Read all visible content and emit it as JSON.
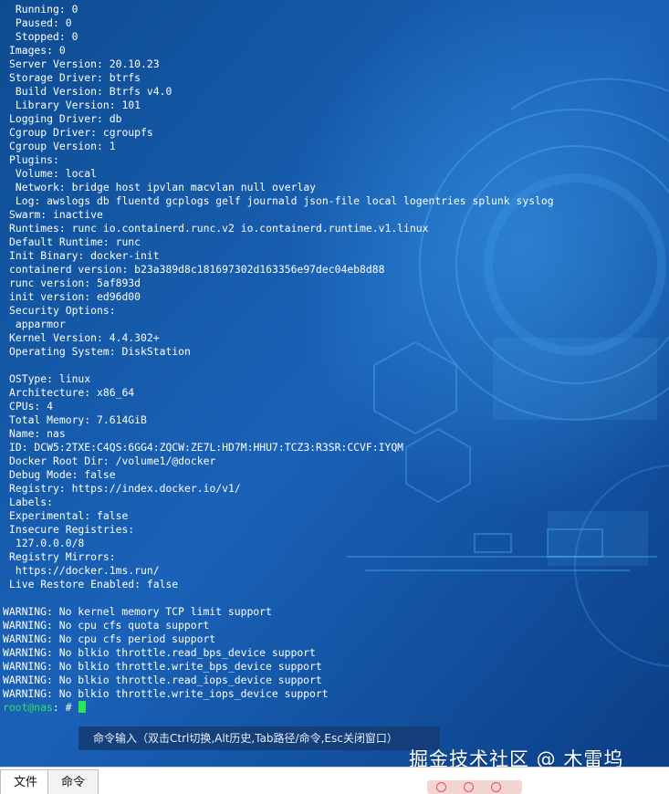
{
  "terminal": {
    "lines": [
      " Running: 0",
      " Paused: 0",
      " Stopped: 0",
      "Images: 0",
      "Server Version: 20.10.23",
      "Storage Driver: btrfs",
      " Build Version: Btrfs v4.0",
      " Library Version: 101",
      "Logging Driver: db",
      "Cgroup Driver: cgroupfs",
      "Cgroup Version: 1",
      "Plugins:",
      " Volume: local",
      " Network: bridge host ipvlan macvlan null overlay",
      " Log: awslogs db fluentd gcplogs gelf journald json-file local logentries splunk syslog",
      "Swarm: inactive",
      "Runtimes: runc io.containerd.runc.v2 io.containerd.runtime.v1.linux",
      "Default Runtime: runc",
      "Init Binary: docker-init",
      "containerd version: b23a389d8c181697302d163356e97dec04eb8d88",
      "runc version: 5af893d",
      "init version: ed96d00",
      "Security Options:",
      " apparmor",
      "Kernel Version: 4.4.302+",
      "Operating System: DiskStation",
      "",
      "OSType: linux",
      "Architecture: x86_64",
      "CPUs: 4",
      "Total Memory: 7.614GiB",
      "Name: nas",
      "ID: DCW5:2TXE:C4QS:6GG4:ZQCW:ZE7L:HD7M:HHU7:TCZ3:R3SR:CCVF:IYQM",
      "Docker Root Dir: /volume1/@docker",
      "Debug Mode: false",
      "Registry: https://index.docker.io/v1/",
      "Labels:",
      "Experimental: false",
      "Insecure Registries:",
      " 127.0.0.0/8",
      "Registry Mirrors:",
      " https://docker.1ms.run/",
      "Live Restore Enabled: false",
      "",
      "WARNING: No kernel memory TCP limit support",
      "WARNING: No cpu cfs quota support",
      "WARNING: No cpu cfs period support",
      "WARNING: No blkio throttle.read_bps_device support",
      "WARNING: No blkio throttle.write_bps_device support",
      "WARNING: No blkio throttle.read_iops_device support",
      "WARNING: No blkio throttle.write_iops_device support"
    ],
    "prompt_user": "root@nas",
    "prompt_sep": ":",
    "prompt_path": " #"
  },
  "command_bar": {
    "placeholder": "命令输入（双击Ctrl切换,Alt历史,Tab路径/命令,Esc关闭窗口）"
  },
  "watermark": "掘金技术社区 @ 木雷坞",
  "bottom_tabs": [
    "文件",
    "命令"
  ],
  "colors": {
    "prompt_user": "#2ee35a",
    "background": "#0b3c7a"
  }
}
